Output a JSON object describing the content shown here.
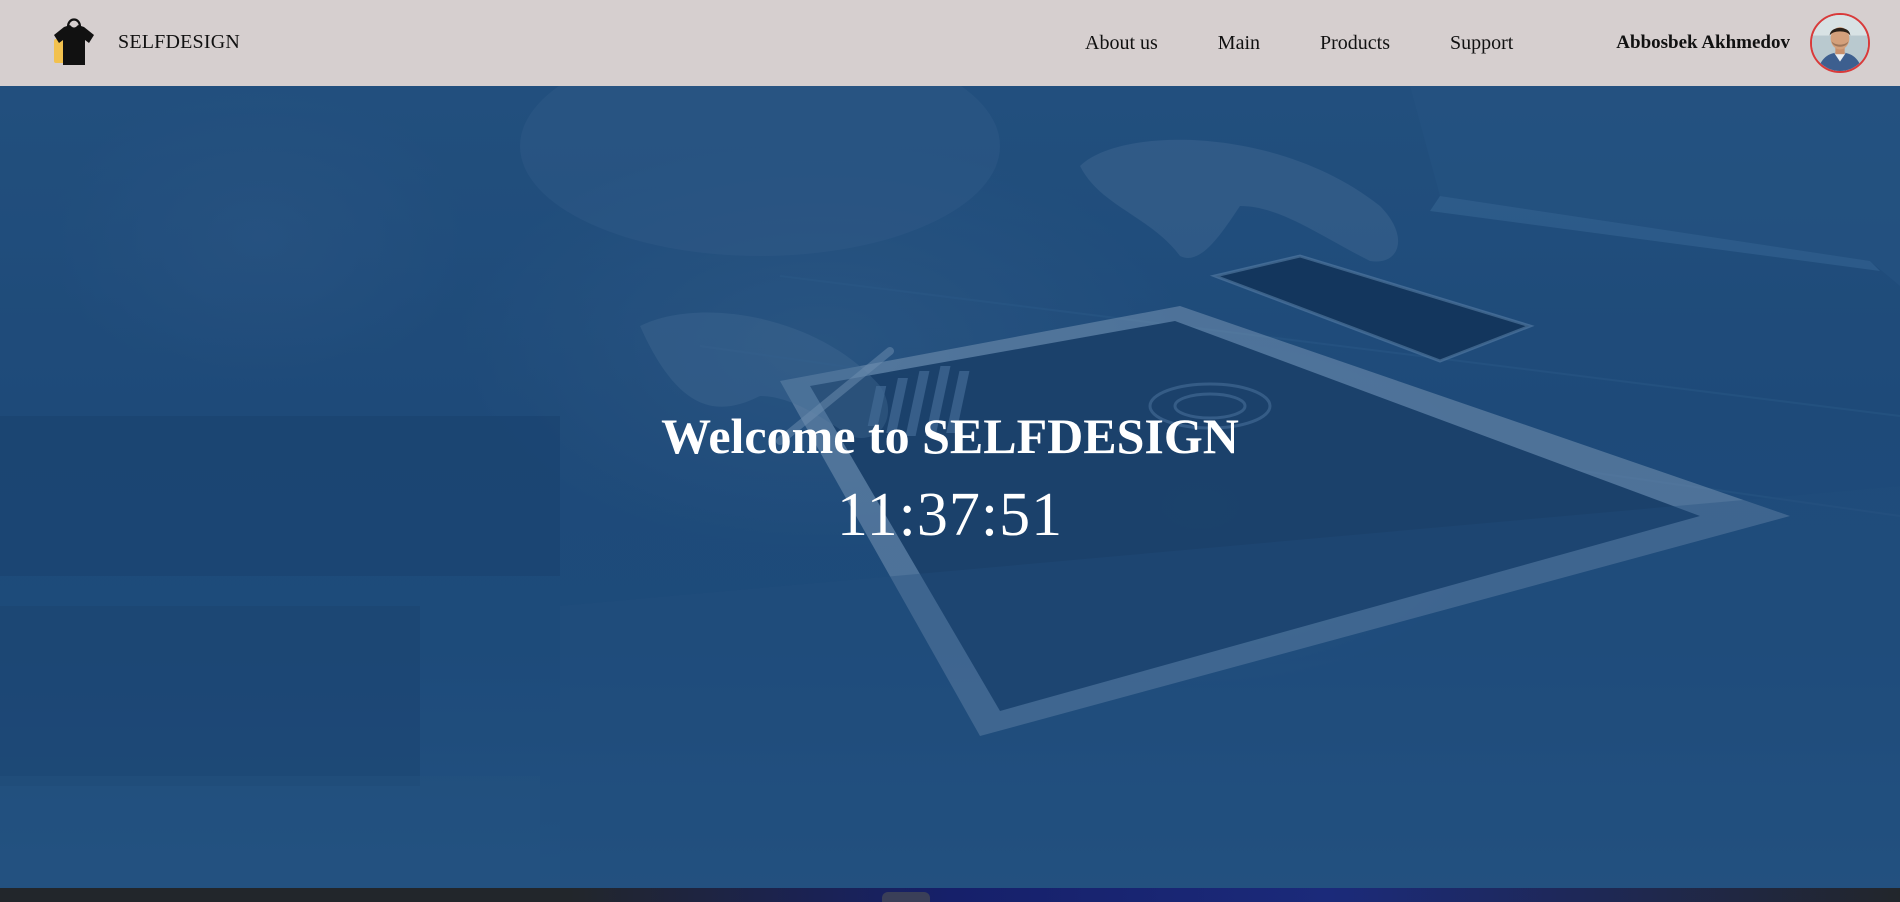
{
  "header": {
    "brand_name": "SELFDESIGN",
    "logo_icon": "shopping-bag-tshirt-icon",
    "nav": [
      {
        "label": "About us"
      },
      {
        "label": "Main"
      },
      {
        "label": "Products"
      },
      {
        "label": "Support"
      }
    ],
    "user": {
      "name": "Abbosbek Akhmedov",
      "avatar_icon": "user-avatar-photo"
    },
    "colors": {
      "background": "#d6cfcf",
      "avatar_border": "#d93a3a"
    }
  },
  "hero": {
    "title": "Welcome to SELFDESIGN",
    "clock": "11:37:51",
    "background_description_icon": "hands-tablet-photo",
    "colors": {
      "overlay": "#23507f",
      "text": "#ffffff"
    }
  }
}
